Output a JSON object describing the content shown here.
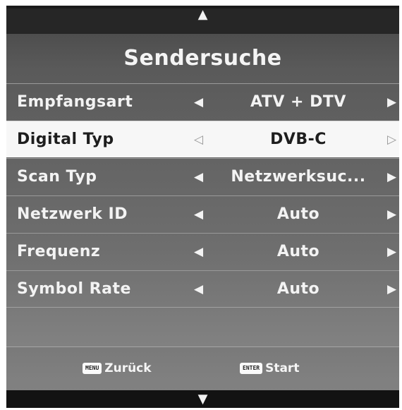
{
  "nav": {
    "up_arrow": "▲",
    "down_arrow": "▼"
  },
  "menu": {
    "title": "Sendersuche",
    "rows": [
      {
        "label": "Empfangsart",
        "left": "◀",
        "value": "ATV + DTV",
        "right": "▶"
      },
      {
        "label": "Digital Typ",
        "left": "◁",
        "value": "DVB-C",
        "right": "▷",
        "selected": true
      },
      {
        "label": "Scan Typ",
        "left": "◀",
        "value": "Netzwerksuc...",
        "right": "▶"
      },
      {
        "label": "Netzwerk ID",
        "left": "◀",
        "value": "Auto",
        "right": "▶"
      },
      {
        "label": "Frequenz",
        "left": "◀",
        "value": "Auto",
        "right": "▶"
      },
      {
        "label": "Symbol Rate",
        "left": "◀",
        "value": "Auto",
        "right": "▶"
      }
    ]
  },
  "footer": {
    "back_key": "MENU",
    "back_label": "Zurück",
    "start_key": "ENTER",
    "start_label": "Start"
  },
  "colors": {
    "frame": "#1b1b1b",
    "selected_row": "#f7f7f7",
    "text": "#f3f3f3"
  }
}
